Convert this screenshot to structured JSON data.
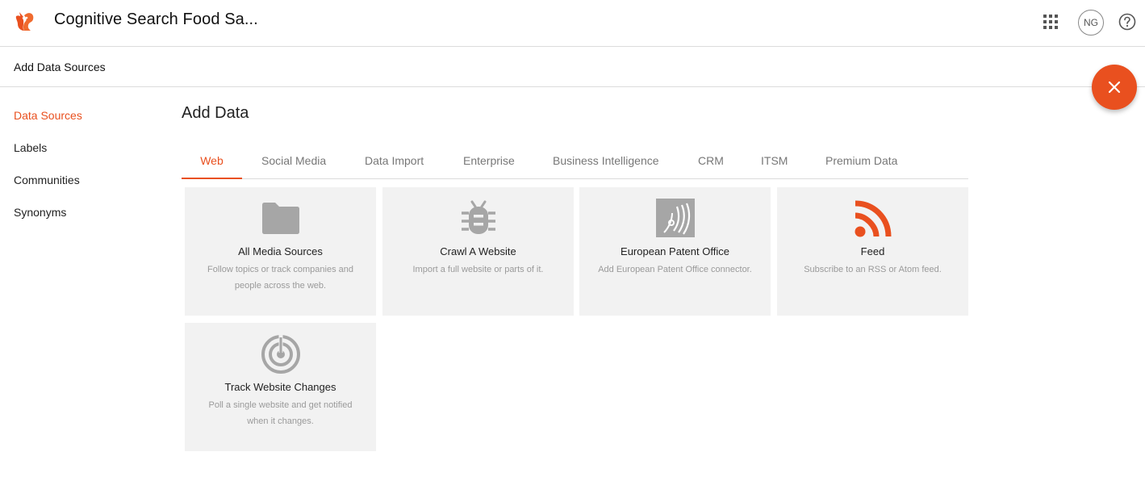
{
  "header": {
    "app_title": "Cognitive Search Food Sa...",
    "user_initials": "NG"
  },
  "subheader": {
    "title": "Add Data Sources"
  },
  "sidebar": {
    "items": [
      {
        "label": "Data Sources",
        "active": true
      },
      {
        "label": "Labels",
        "active": false
      },
      {
        "label": "Communities",
        "active": false
      },
      {
        "label": "Synonyms",
        "active": false
      }
    ]
  },
  "main": {
    "title": "Add Data",
    "tabs": [
      {
        "label": "Web",
        "active": true
      },
      {
        "label": "Social Media"
      },
      {
        "label": "Data Import"
      },
      {
        "label": "Enterprise"
      },
      {
        "label": "Business Intelligence"
      },
      {
        "label": "CRM"
      },
      {
        "label": "ITSM"
      },
      {
        "label": "Premium Data"
      }
    ],
    "cards": [
      {
        "icon": "folder-icon",
        "title": "All Media Sources",
        "description": "Follow topics or track companies and people across the web."
      },
      {
        "icon": "bug-icon",
        "title": "Crawl A Website",
        "description": "Import a full website or parts of it."
      },
      {
        "icon": "patent-office-icon",
        "title": "European Patent Office",
        "description": "Add European Patent Office connector."
      },
      {
        "icon": "rss-icon",
        "title": "Feed",
        "description": "Subscribe to an RSS or Atom feed."
      },
      {
        "icon": "radar-icon",
        "title": "Track Website Changes",
        "description": "Poll a single website and get notified when it changes."
      }
    ]
  },
  "colors": {
    "accent": "#e9501f",
    "card_bg": "#f2f2f2",
    "icon_gray": "#a6a6a6"
  }
}
